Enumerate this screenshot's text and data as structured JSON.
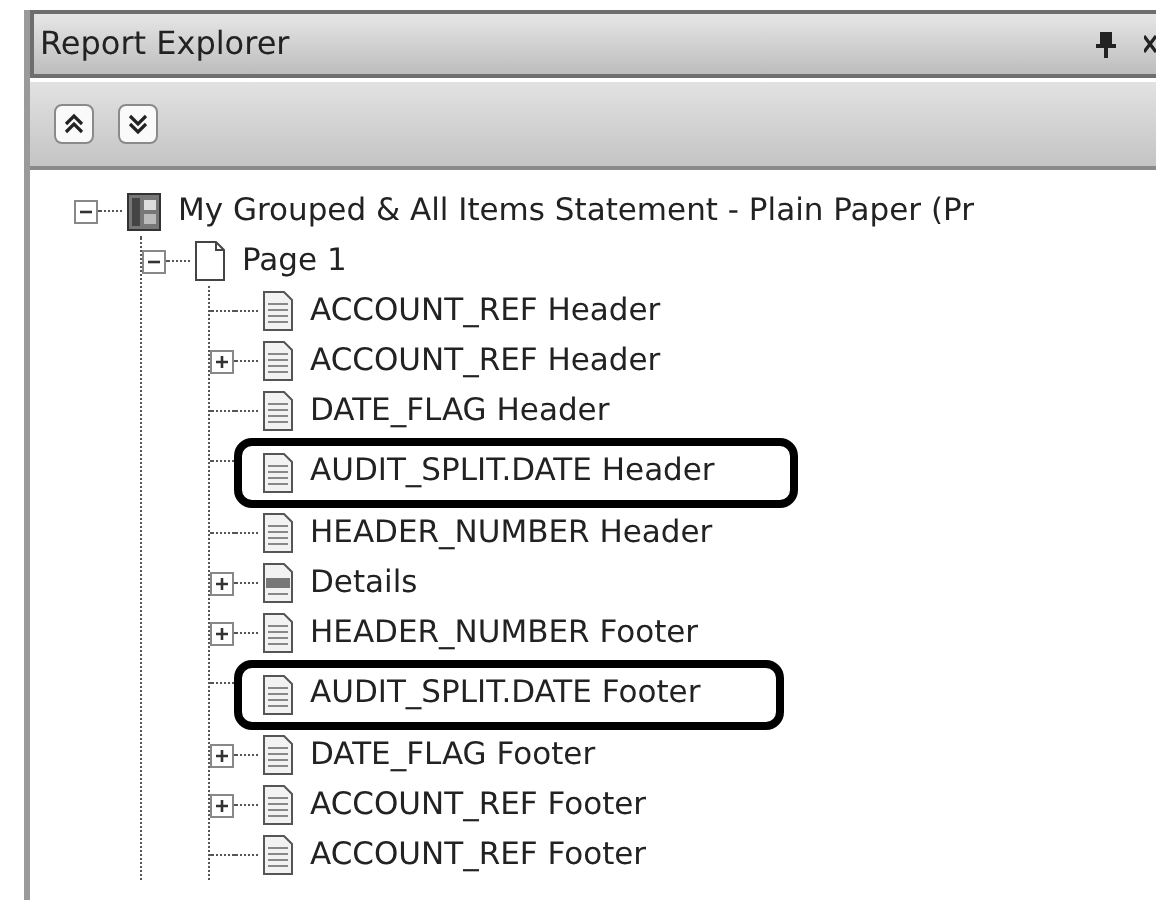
{
  "panel": {
    "title": "Report Explorer"
  },
  "toolbar": {
    "buttons": [
      {
        "kind": "collapse-all"
      },
      {
        "kind": "expand-all"
      }
    ]
  },
  "tree": [
    {
      "label": "My Grouped & All Items Statement - Plain Paper (Pr",
      "kind": "report",
      "expanded": true,
      "children": [
        {
          "label": "Page 1",
          "kind": "page",
          "expanded": true,
          "children": [
            {
              "label": "ACCOUNT_REF Header",
              "kind": "section",
              "highlighted": false
            },
            {
              "label": "ACCOUNT_REF Header",
              "kind": "section",
              "expanded": false,
              "highlighted": false
            },
            {
              "label": "DATE_FLAG Header",
              "kind": "section",
              "highlighted": false
            },
            {
              "label": "AUDIT_SPLIT.DATE Header",
              "kind": "section",
              "highlighted": true
            },
            {
              "label": "HEADER_NUMBER Header",
              "kind": "section",
              "highlighted": false
            },
            {
              "label": "Details",
              "kind": "details",
              "expanded": false,
              "highlighted": false
            },
            {
              "label": "HEADER_NUMBER Footer",
              "kind": "section",
              "expanded": false,
              "highlighted": false
            },
            {
              "label": "AUDIT_SPLIT.DATE Footer",
              "kind": "section",
              "highlighted": true
            },
            {
              "label": "DATE_FLAG Footer",
              "kind": "section",
              "expanded": false,
              "highlighted": false
            },
            {
              "label": "ACCOUNT_REF Footer",
              "kind": "section",
              "expanded": false,
              "highlighted": false
            },
            {
              "label": "ACCOUNT_REF Footer",
              "kind": "section",
              "highlighted": false
            }
          ]
        }
      ]
    }
  ]
}
